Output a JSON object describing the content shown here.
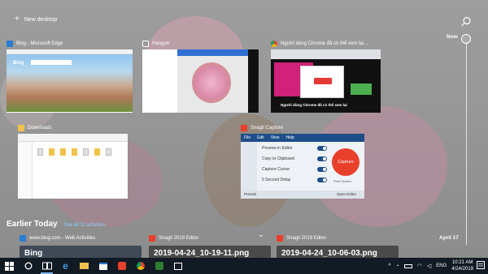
{
  "new_desktop": {
    "label": "New desktop"
  },
  "timeline": {
    "now_label": "Now",
    "date_label": "April 17"
  },
  "windows": [
    {
      "title": "Bing - Microsoft Edge",
      "icon": "edge-icon",
      "page_brand": "Bing"
    },
    {
      "title": "Hangon",
      "icon": "photos-icon"
    },
    {
      "title": "Người dùng Chrome đã có thể xem lại…",
      "icon": "chrome-icon",
      "page_caption": "Người dùng Chrome đã có thể xem lại"
    },
    {
      "title": "Downloads",
      "icon": "folder-icon"
    },
    {
      "title": "Snagit Capture",
      "icon": "snagit-icon",
      "menu": [
        "File",
        "Edit",
        "View",
        "Help"
      ],
      "options": [
        "Preview in Editor",
        "Copy to Clipboard",
        "Capture Cursor",
        "5 Second Delay"
      ],
      "capture_label": "Capture",
      "print_label": "Print Screen",
      "presets_label": "Presets",
      "open_editor_label": "Open Editor"
    }
  ],
  "earlier": {
    "heading": "Earlier Today",
    "see_all": "See all 11 activities",
    "activities": [
      {
        "title": "www.bing.com - Web Activities",
        "icon": "edge-icon",
        "card_text": "Bing"
      },
      {
        "title": "Snagit 2019 Editor",
        "icon": "snagit-icon",
        "card_text": "2019-04-24_10-19-11.png"
      },
      {
        "title": "Snagit 2019 Editor",
        "icon": "snagit-icon",
        "card_text": "2019-04-24_10-06-03.png"
      }
    ]
  },
  "taskbar": {
    "apps": [
      "start-icon",
      "cortana-icon",
      "task-view-icon",
      "edge-icon",
      "file-explorer-icon",
      "store-icon",
      "snagit-icon",
      "chrome-icon",
      "snagit-editor-icon",
      "photos-icon"
    ],
    "lang": "ENG",
    "time": "10:21 AM",
    "date": "4/24/2019"
  },
  "colors": {
    "taskbar": "#121a24",
    "accent": "#7fb6ea",
    "snagit_red": "#e8402b",
    "snagit_blue": "#1d4e89"
  }
}
